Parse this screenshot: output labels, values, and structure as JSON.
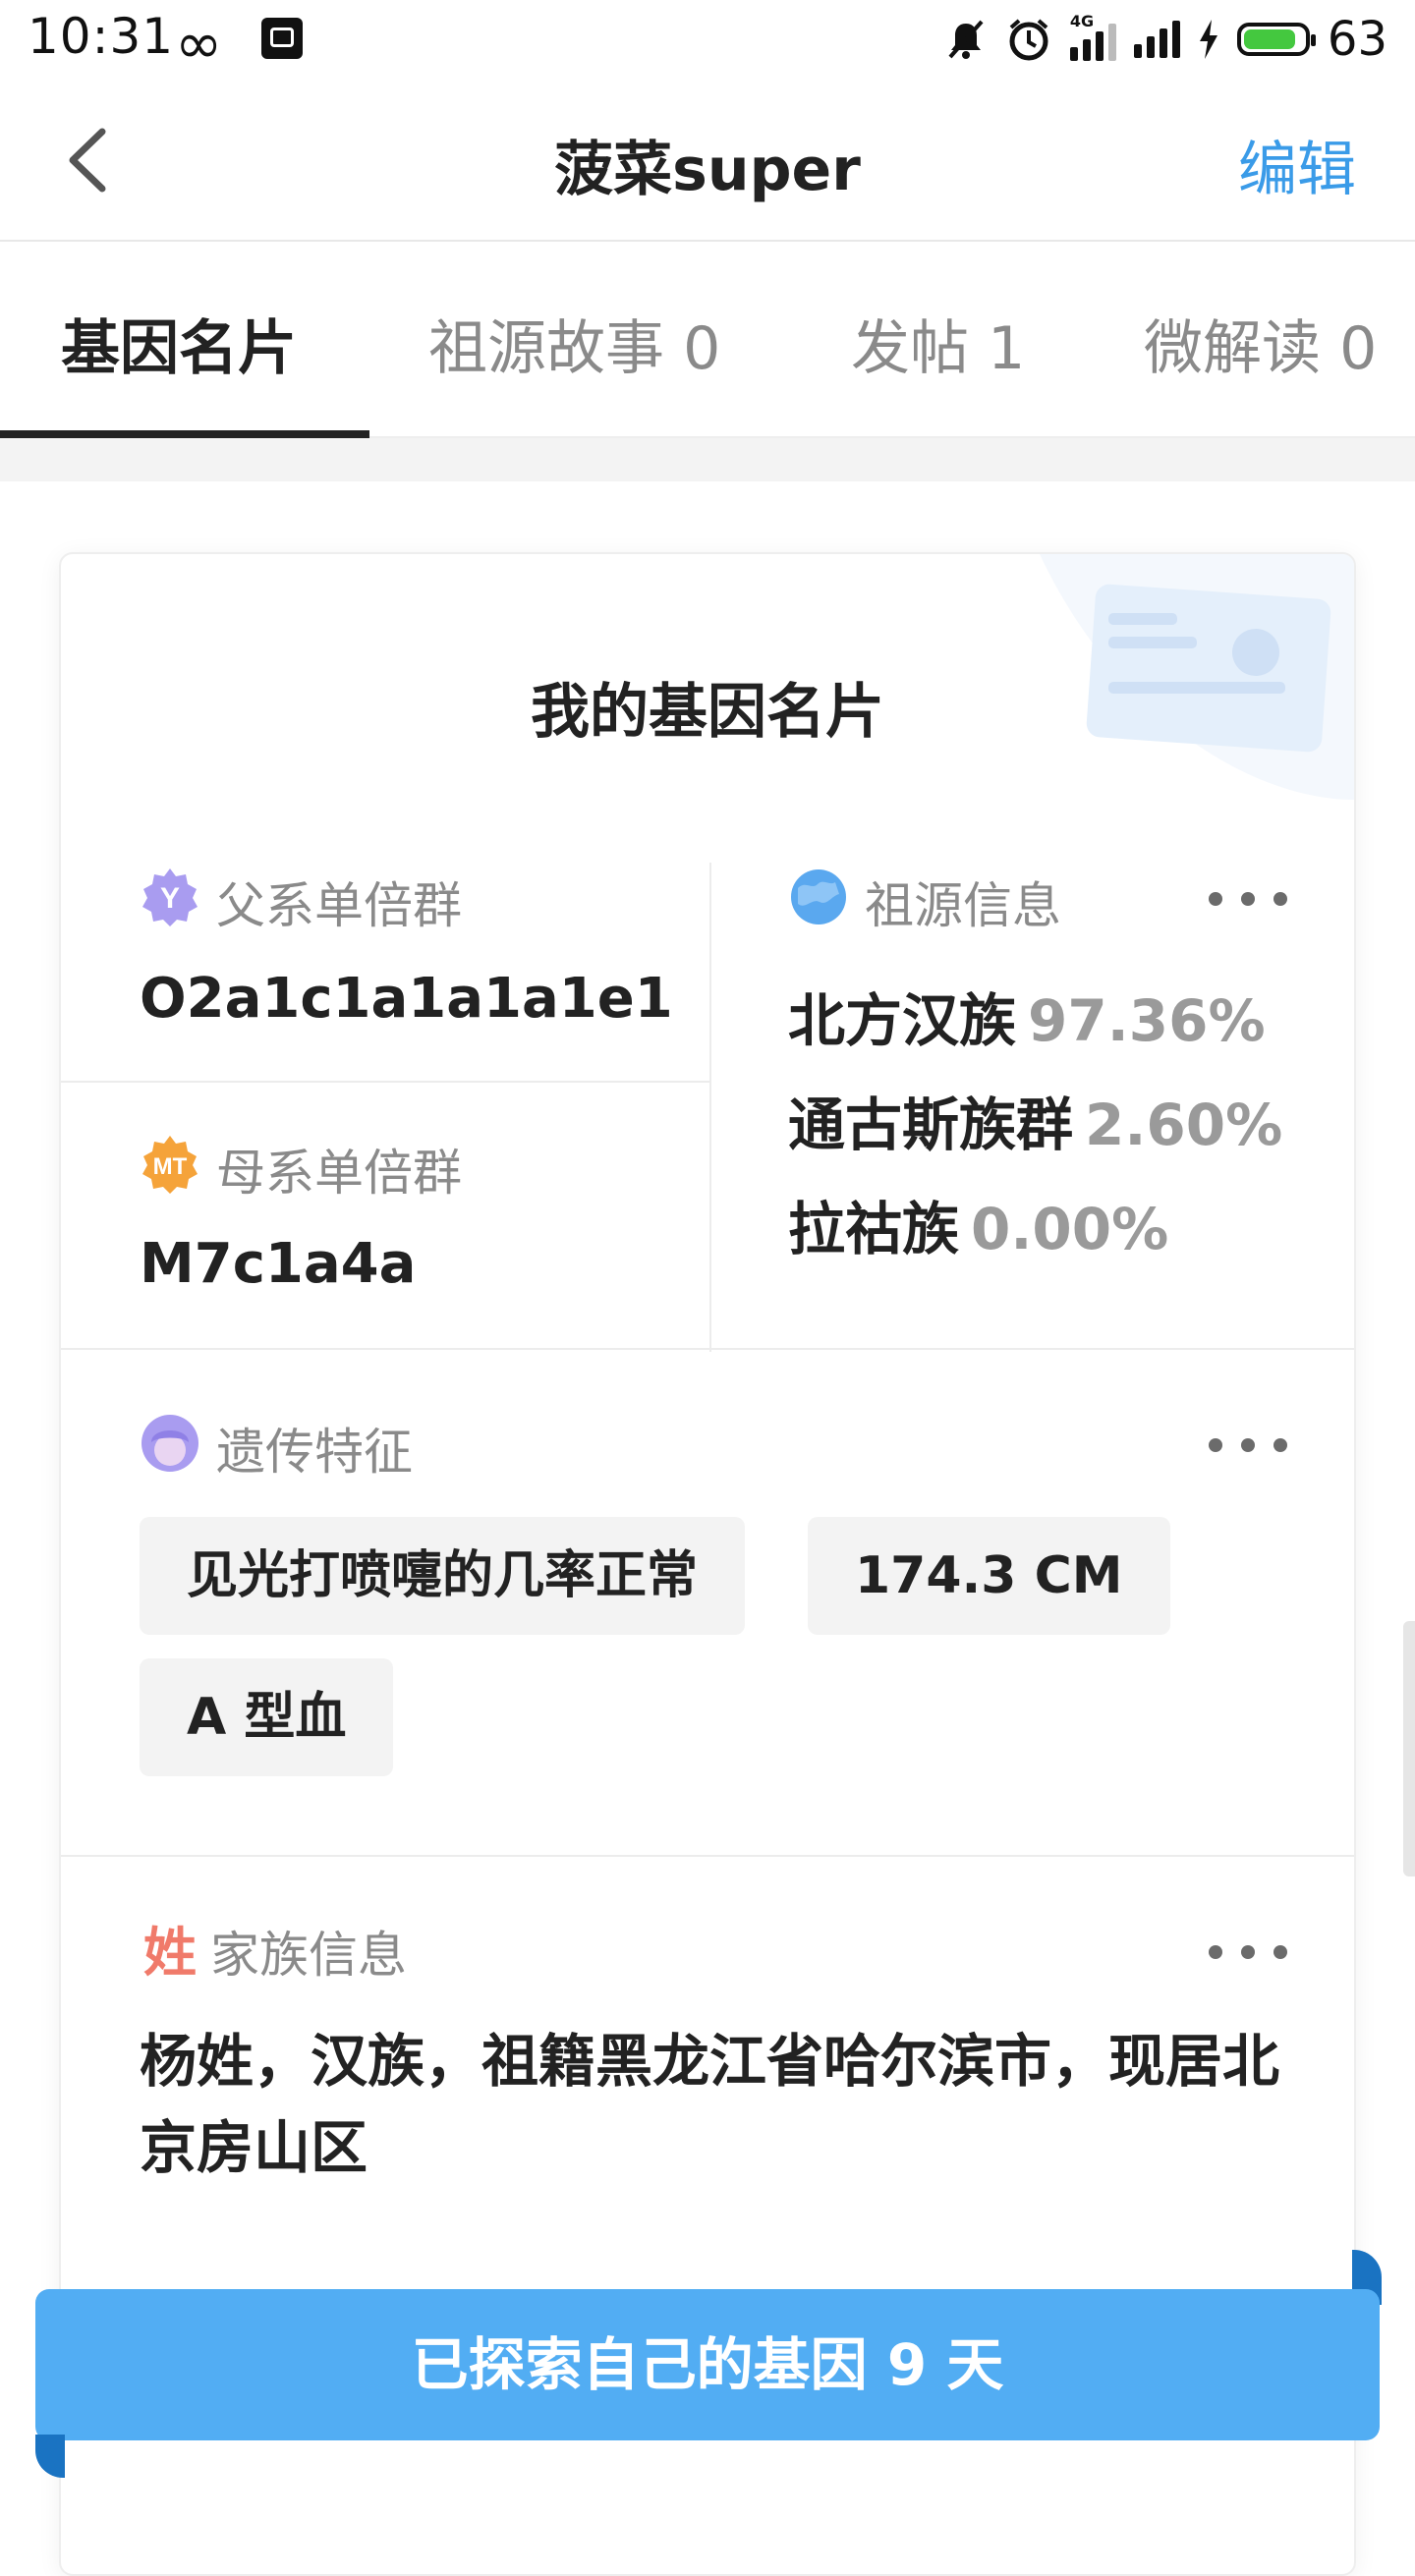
{
  "status_bar": {
    "time": "10:31",
    "battery_level": "63",
    "network_label": "4G",
    "icons": [
      "infinity-icon",
      "app-notification-icon",
      "mute-icon",
      "alarm-icon",
      "signal-4g-icon",
      "signal-icon",
      "charging-icon",
      "battery-icon"
    ]
  },
  "nav": {
    "back_icon": "chevron-left-icon",
    "title": "菠菜super",
    "edit_label": "编辑"
  },
  "tabs": [
    {
      "label": "基因名片",
      "active": true
    },
    {
      "label": "祖源故事 0",
      "active": false
    },
    {
      "label": "发帖 1",
      "active": false
    },
    {
      "label": "微解读 0",
      "active": false
    }
  ],
  "card": {
    "title": "我的基因名片",
    "decoration_icon": "id-card-icon",
    "paternal": {
      "icon": "y-badge-icon",
      "icon_text": "Y",
      "label": "父系单倍群",
      "value": "O2a1c1a1a1a1e1"
    },
    "maternal": {
      "icon": "mt-badge-icon",
      "icon_text": "MT",
      "label": "母系单倍群",
      "value": "M7c1a4a"
    },
    "ancestry": {
      "icon": "globe-icon",
      "label": "祖源信息",
      "items": [
        {
          "name": "北方汉族",
          "percent": "97.36%"
        },
        {
          "name": "通古斯族群",
          "percent": "2.60%"
        },
        {
          "name": "拉祜族",
          "percent": "0.00%"
        }
      ]
    },
    "traits": {
      "icon": "avatar-trait-icon",
      "label": "遗传特征",
      "chips": [
        "见光打喷嚏的几率正常",
        "174.3 CM",
        "A 型血"
      ]
    },
    "family": {
      "icon": "surname-icon",
      "icon_text": "姓",
      "label": "家族信息",
      "text": "杨姓，汉族，祖籍黑龙江省哈尔滨市，现居北京房山区"
    }
  },
  "banner": {
    "text": "已探索自己的基因 9 天"
  },
  "colors": {
    "accent_blue": "#3a9be8",
    "banner_blue": "#52adf3",
    "paternal_purple": "#a99cf0",
    "maternal_orange": "#f5a33a",
    "ancestry_blue": "#5aa8ef",
    "surname_red": "#f07a6a"
  }
}
